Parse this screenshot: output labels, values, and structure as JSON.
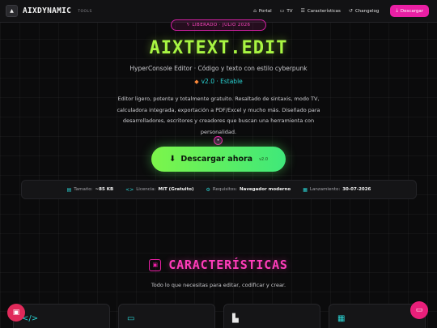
{
  "header": {
    "brand_name": "AIXDYNAMIC",
    "brand_sub": "TOOLS",
    "nav": [
      {
        "label": "Portal",
        "icon": "home-icon"
      },
      {
        "label": "TV",
        "icon": "tv-icon"
      },
      {
        "label": "Características",
        "icon": "list-icon"
      },
      {
        "label": "Changelog",
        "icon": "history-icon"
      }
    ],
    "download_label": "Descargar"
  },
  "hero": {
    "release_badge": "LIBERADO · JULIO 2026",
    "title": "AIXTEXT.EDIT",
    "subtitle": "HyperConsole Editor · Código y texto con estilo cyberpunk",
    "version": "v2.0 · Estable",
    "description": "Editor ligero, potente y totalmente gratuito. Resaltado de sintaxis, modo TV, calculadora integrada, exportación a PDF/Excel y mucho más. Diseñado para desarrolladores, escritores y creadores que buscan una herramienta con personalidad.",
    "cta_label": "Descargar ahora",
    "cta_version": "v2.0"
  },
  "info": {
    "size_label": "Tamaño:",
    "size_value": "~85 KB",
    "license_label": "Licencia:",
    "license_value": "MIT (Gratuito)",
    "req_label": "Requisitos:",
    "req_value": "Navegador moderno",
    "launch_label": "Lanzamiento:",
    "launch_value": "30-07-2026"
  },
  "features": {
    "title": "CARACTERÍSTICAS",
    "subtitle": "Todo lo que necesitas para editar, codificar y crear."
  },
  "colors": {
    "accent_green": "#a8f542",
    "accent_pink": "#ff3dbb",
    "accent_cyan": "#2ad4d4"
  }
}
